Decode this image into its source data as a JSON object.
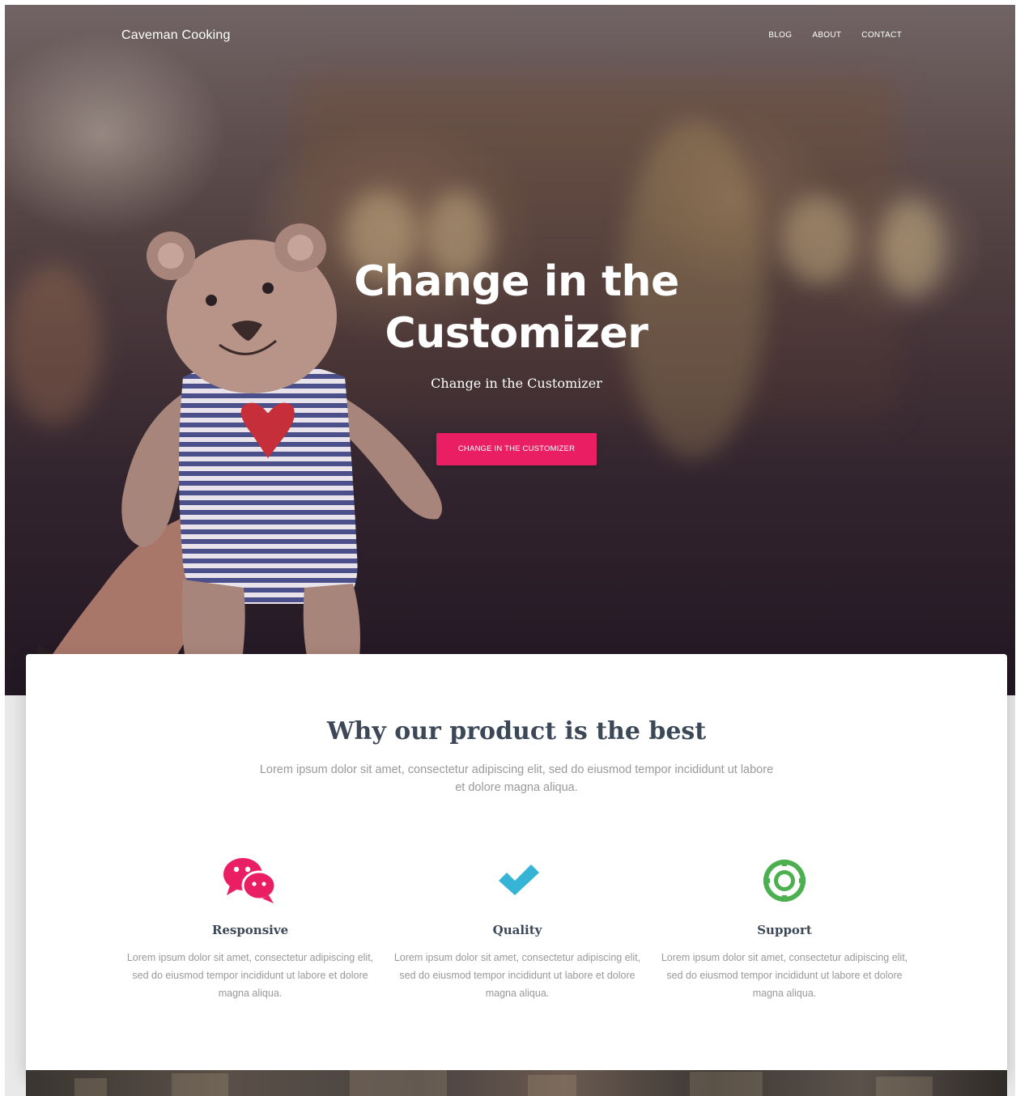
{
  "header": {
    "brand": "Caveman Cooking",
    "nav": [
      {
        "label": "BLOG"
      },
      {
        "label": "ABOUT"
      },
      {
        "label": "CONTACT"
      }
    ]
  },
  "hero": {
    "title": "Change in the Customizer",
    "subtitle": "Change in the Customizer",
    "button_label": "CHANGE IN THE CUSTOMIZER"
  },
  "features": {
    "title": "Why our product is the best",
    "description": "Lorem ipsum dolor sit amet, consectetur adipiscing elit, sed do eiusmod tempor incididunt ut labore et dolore magna aliqua.",
    "items": [
      {
        "icon": "chat-bubbles-icon",
        "color": "#e91e63",
        "title": "Responsive",
        "text": "Lorem ipsum dolor sit amet, consectetur adipiscing elit, sed do eiusmod tempor incididunt ut labore et dolore magna aliqua."
      },
      {
        "icon": "checkmark-icon",
        "color": "#36b4d6",
        "title": "Quality",
        "text": "Lorem ipsum dolor sit amet, consectetur adipiscing elit, sed do eiusmod tempor incididunt ut labore et dolore magna aliqua."
      },
      {
        "icon": "life-ring-icon",
        "color": "#4caf50",
        "title": "Support",
        "text": "Lorem ipsum dolor sit amet, consectetur adipiscing elit, sed do eiusmod tempor incididunt ut labore et dolore magna aliqua."
      }
    ]
  },
  "colors": {
    "accent": "#e91e63",
    "heading": "#3c4858",
    "muted_text": "#999999"
  }
}
